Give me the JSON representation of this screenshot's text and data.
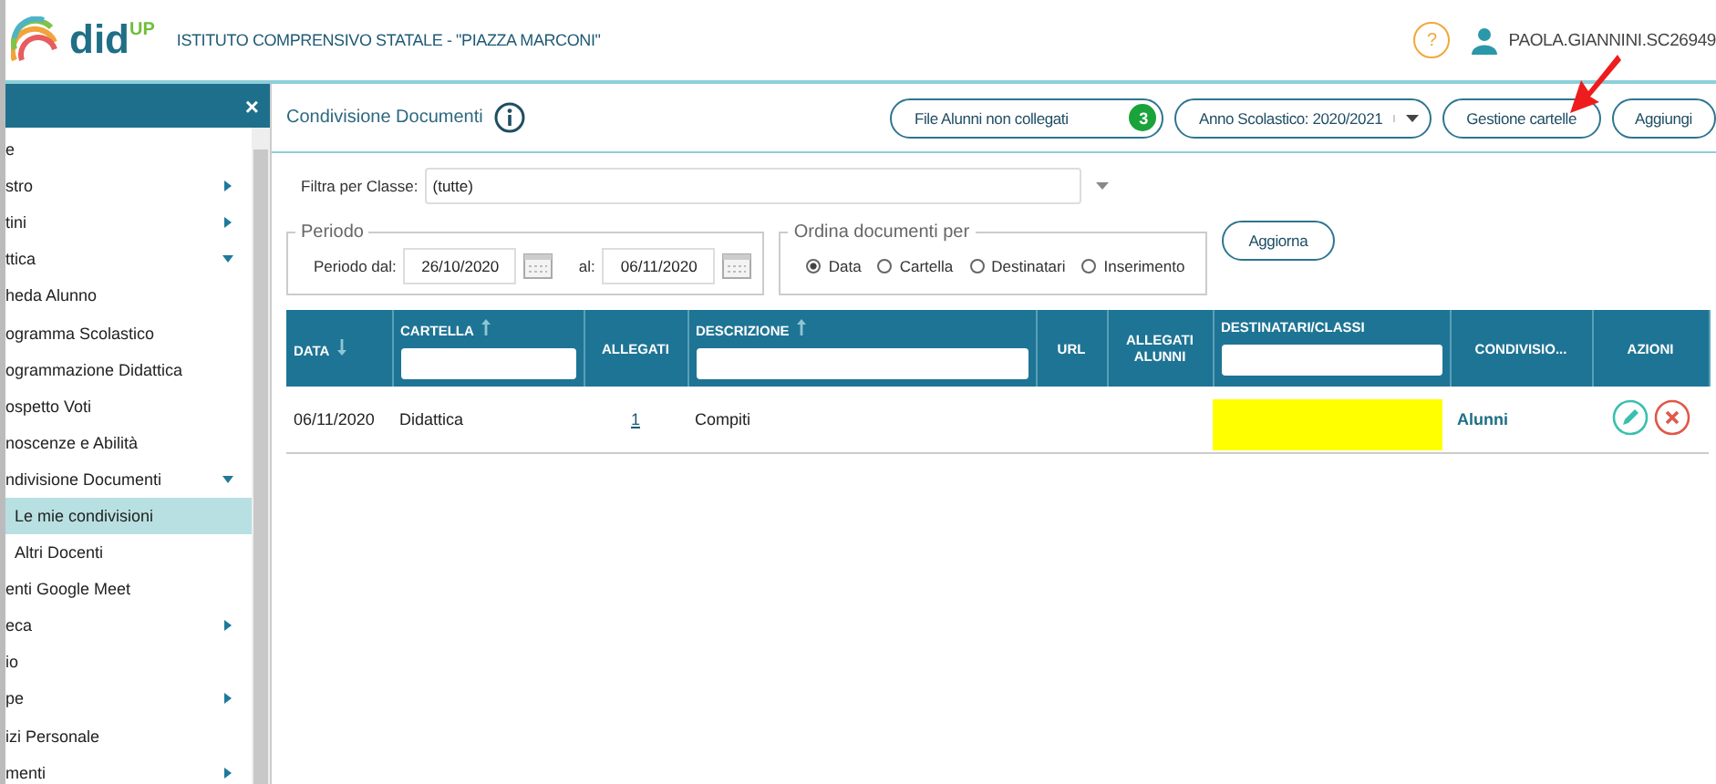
{
  "header": {
    "logo": "did",
    "logo_sup": "UP",
    "school": "ISTITUTO COMPRENSIVO STATALE - \"PIAZZA MARCONI\"",
    "help": "?",
    "user": "PAOLA.GIANNINI.SC26949"
  },
  "sidebar": {
    "close": "×",
    "items": [
      {
        "label": "e"
      },
      {
        "label": "stro",
        "expanded": false
      },
      {
        "label": "tini",
        "expanded": false
      },
      {
        "label": "ttica",
        "expanded": true
      },
      {
        "label": "heda Alunno"
      },
      {
        "label": "ogramma Scolastico"
      },
      {
        "label": "ogrammazione Didattica"
      },
      {
        "label": "ospetto Voti"
      },
      {
        "label": "noscenze e Abilità"
      },
      {
        "label": "ndivisione Documenti",
        "expanded": true
      },
      {
        "label": "Le mie condivisioni",
        "selected": true
      },
      {
        "label": "Altri Docenti",
        "selected": false
      },
      {
        "label": "enti Google Meet"
      },
      {
        "label": "eca",
        "expanded": false
      },
      {
        "label": "io"
      },
      {
        "label": "pe",
        "expanded": false
      },
      {
        "label": "izi Personale"
      },
      {
        "label": "menti",
        "expanded": false
      }
    ]
  },
  "page": {
    "title": "Condivisione Documenti",
    "buttons": [
      {
        "kind": "badge",
        "label": "File Alunni non collegati",
        "badge": "3"
      },
      {
        "kind": "dropdown",
        "label": "Anno Scolastico: 2020/2021"
      },
      {
        "kind": "plain",
        "label": "Gestione cartelle"
      },
      {
        "kind": "plain",
        "label": "Aggiungi"
      }
    ]
  },
  "filter": {
    "label": "Filtra per Classe:",
    "value": "(tutte)"
  },
  "period": {
    "legend": "Periodo",
    "from_label": "Periodo dal:",
    "from": "26/10/2020",
    "to_label": "al:",
    "to": "06/11/2020"
  },
  "order": {
    "legend": "Ordina documenti per",
    "options": [
      {
        "label": "Data",
        "selected": true
      },
      {
        "label": "Cartella",
        "selected": false
      },
      {
        "label": "Destinatari",
        "selected": false
      },
      {
        "label": "Inserimento",
        "selected": false
      }
    ]
  },
  "refresh": "Aggiorna",
  "table": {
    "columns": [
      {
        "label": "DATA",
        "sorted_ascending": false,
        "filter": false
      },
      {
        "label": "CARTELLA",
        "sorted_ascending": true,
        "filter": true
      },
      {
        "label": "ALLEGATI",
        "filter": false
      },
      {
        "label": "DESCRIZIONE",
        "sorted_ascending": true,
        "filter": true
      },
      {
        "label": "URL",
        "filter": false
      },
      {
        "label": "ALLEGATI ALUNNI",
        "filter": false
      },
      {
        "label": "DESTINATARI/CLASSI",
        "filter": true
      },
      {
        "label": "CONDIVISIO...",
        "filter": false
      },
      {
        "label": "AZIONI",
        "filter": false
      }
    ],
    "rows": [
      {
        "date": "06/11/2020",
        "folder": "Didattica",
        "attachments": "1",
        "description": "Compiti",
        "redacted": true,
        "shared_with": "Alunni"
      }
    ]
  }
}
